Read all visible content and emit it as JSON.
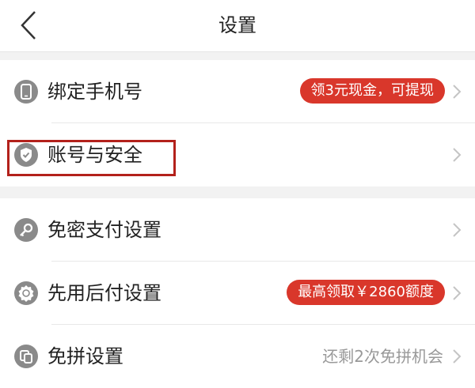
{
  "header": {
    "title": "设置"
  },
  "sections": [
    {
      "items": [
        {
          "label": "绑定手机号",
          "icon": "phone-icon",
          "badge": "领3元现金，可提现"
        },
        {
          "label": "账号与安全",
          "icon": "shield-check-icon"
        }
      ]
    },
    {
      "items": [
        {
          "label": "免密支付设置",
          "icon": "key-icon"
        },
        {
          "label": "先用后付设置",
          "icon": "seal-icon",
          "badge": "最高领取￥2860额度"
        },
        {
          "label": "免拼设置",
          "icon": "group-icon",
          "hint": "还剩2次免拼机会"
        }
      ]
    }
  ],
  "colors": {
    "badge": "#d9372b",
    "highlight": "#b3211b",
    "icon_gray": "#8a8a8a"
  }
}
